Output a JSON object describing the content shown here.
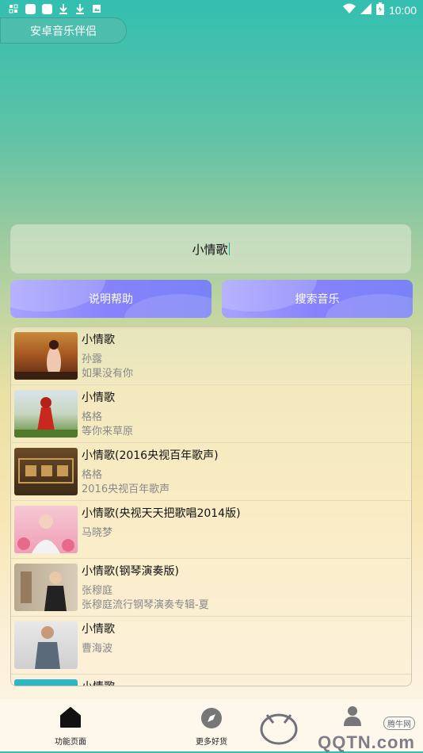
{
  "status_bar": {
    "time": "10:00",
    "icons": [
      "screen-icon",
      "square-icon",
      "square-icon",
      "download-icon",
      "download-icon",
      "image-icon",
      "wifi-icon",
      "signal-icon",
      "battery-icon"
    ]
  },
  "app": {
    "title": "安卓音乐伴侣"
  },
  "search": {
    "value": "小情歌"
  },
  "buttons": {
    "help": "说明帮助",
    "search": "搜索音乐"
  },
  "songs": [
    {
      "title": "小情歌",
      "artist": "孙露",
      "album": "如果没有你"
    },
    {
      "title": "小情歌",
      "artist": "格格",
      "album": "等你来草原"
    },
    {
      "title": "小情歌(2016央视百年歌声)",
      "artist": "格格",
      "album": "2016央视百年歌声"
    },
    {
      "title": "小情歌(央视天天把歌唱2014版)",
      "artist": "马晓梦",
      "album": ""
    },
    {
      "title": "小情歌(钢琴演奏版)",
      "artist": "张穆庭",
      "album": "张穆庭流行钢琴演奏专辑-夏"
    },
    {
      "title": "小情歌",
      "artist": "曹海波",
      "album": ""
    },
    {
      "title": "小情歌",
      "artist": "",
      "album": ""
    }
  ],
  "bottom_nav": [
    {
      "label": "功能页面",
      "icon": "home-icon"
    },
    {
      "label": "更多好货",
      "icon": "compass-icon"
    },
    {
      "label": "",
      "icon": "user-icon"
    }
  ],
  "watermark": {
    "text": "QQTN.com",
    "badge": "腾牛网"
  },
  "colors": {
    "accent": "#8682fb",
    "header": "#33bfb0"
  }
}
